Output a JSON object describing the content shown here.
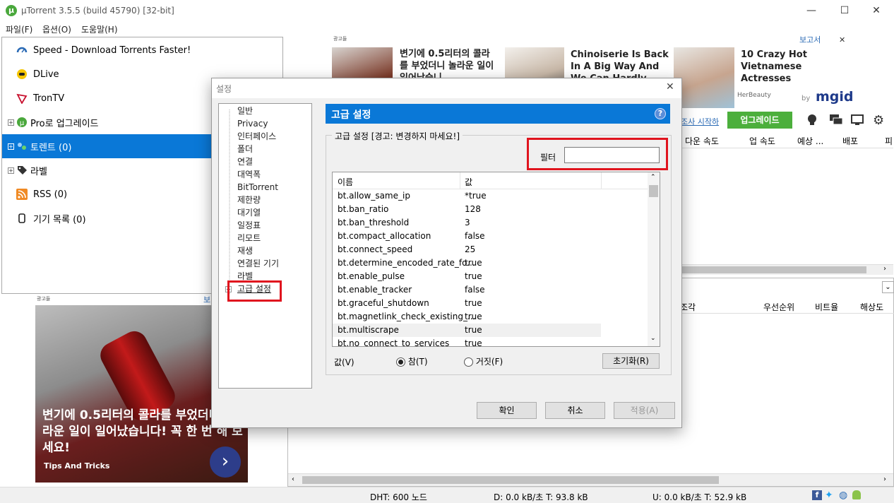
{
  "window": {
    "title": "µTorrent 3.5.5  (build 45790) [32-bit]",
    "minimize": "—",
    "maximize": "☐",
    "close": "✕"
  },
  "menu": [
    "파일(F)",
    "옵션(O)",
    "도움말(H)"
  ],
  "sidebar": {
    "items": [
      {
        "label": "Speed - Download Torrents Faster!",
        "icon": "speed-icon"
      },
      {
        "label": "DLive",
        "icon": "dlive-icon"
      },
      {
        "label": "TronTV",
        "icon": "trontv-icon"
      },
      {
        "label": "Pro로 업그레이드",
        "icon": "utorrent-pro-icon"
      },
      {
        "label": "토렌트 (0)",
        "icon": "torrents-icon"
      },
      {
        "label": "라벨",
        "icon": "label-tag-icon"
      },
      {
        "label": "RSS (0)",
        "icon": "rss-icon"
      },
      {
        "label": "기기 목록 (0)",
        "icon": "device-icon"
      }
    ]
  },
  "top_ad": {
    "label": "광고들",
    "report": "보고서",
    "close": "✕",
    "cards": [
      {
        "text": "변기에 0.5리터의 콜라를 부었더니 놀라운 일이 일어났습니"
      },
      {
        "text": "Chinoiserie Is Back In A Big Way And We Can Hardly"
      },
      {
        "text": "10 Crazy Hot Vietnamese Actresses",
        "source": "HerBeauty"
      }
    ],
    "by": "by",
    "brand": "mgid"
  },
  "toolbar": {
    "survey": "조사 시작하",
    "upgrade": "업그레이드"
  },
  "main_columns": [
    "다운 속도",
    "업 속도",
    "예상 ...",
    "배포",
    "피"
  ],
  "lower_columns": [
    "조각",
    "우선순위",
    "비트율",
    "해상도"
  ],
  "left_ad": {
    "label": "광고들",
    "report": "보",
    "headline": "변기에 0.5리터의 콜라를 부었더니 놀라운 일이 일어났습니다! 꼭 한 번 해 보세요!",
    "brand": "Tips And Tricks",
    "arrow": "›"
  },
  "statusbar": {
    "dht": "DHT: 600 노드",
    "down": "D: 0.0 kB/초 T: 93.8 kB",
    "up": "U: 0.0 kB/초 T: 52.9 kB"
  },
  "dialog": {
    "title": "설정",
    "close": "✕",
    "tree": [
      "일반",
      "Privacy",
      "인터페이스",
      "폴더",
      "연결",
      "대역폭",
      "BitTorrent",
      "제한량",
      "대기열",
      "일정표",
      "리모트",
      "재생",
      "연결된 기기",
      "라벨",
      "고급 설정"
    ],
    "panel_title": "고급 설정",
    "help": "?",
    "group_label": "고급 설정 [경고: 변경하지 마세요!]",
    "filter_label": "필터",
    "filter_value": "",
    "col_name": "이름",
    "col_value": "값",
    "rows": [
      {
        "name": "bt.allow_same_ip",
        "value": "*true"
      },
      {
        "name": "bt.ban_ratio",
        "value": "128"
      },
      {
        "name": "bt.ban_threshold",
        "value": "3"
      },
      {
        "name": "bt.compact_allocation",
        "value": "false"
      },
      {
        "name": "bt.connect_speed",
        "value": "25"
      },
      {
        "name": "bt.determine_encoded_rate_fo...",
        "value": "true"
      },
      {
        "name": "bt.enable_pulse",
        "value": "true"
      },
      {
        "name": "bt.enable_tracker",
        "value": "false"
      },
      {
        "name": "bt.graceful_shutdown",
        "value": "true"
      },
      {
        "name": "bt.magnetlink_check_existing_...",
        "value": "true"
      },
      {
        "name": "bt.multiscrape",
        "value": "true"
      },
      {
        "name": "bt.no_connect_to_services",
        "value": "true"
      }
    ],
    "value_label": "값(V)",
    "radio_true": "참(T)",
    "radio_false": "거짓(F)",
    "reset": "초기화(R)",
    "ok": "확인",
    "cancel": "취소",
    "apply": "적용(A)"
  }
}
